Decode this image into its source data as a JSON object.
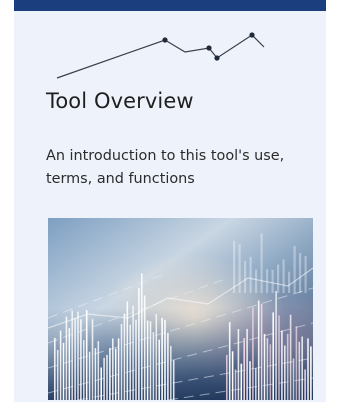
{
  "card": {
    "title": "Tool Overview",
    "description": "An introduction to this tool's use, terms, and functions",
    "accent_color": "#1b3f7e",
    "background_color": "#eef3fb"
  },
  "decoration": {
    "icon": "trend-line-icon"
  },
  "hero_image": {
    "icon": "financial-chart-photo"
  }
}
